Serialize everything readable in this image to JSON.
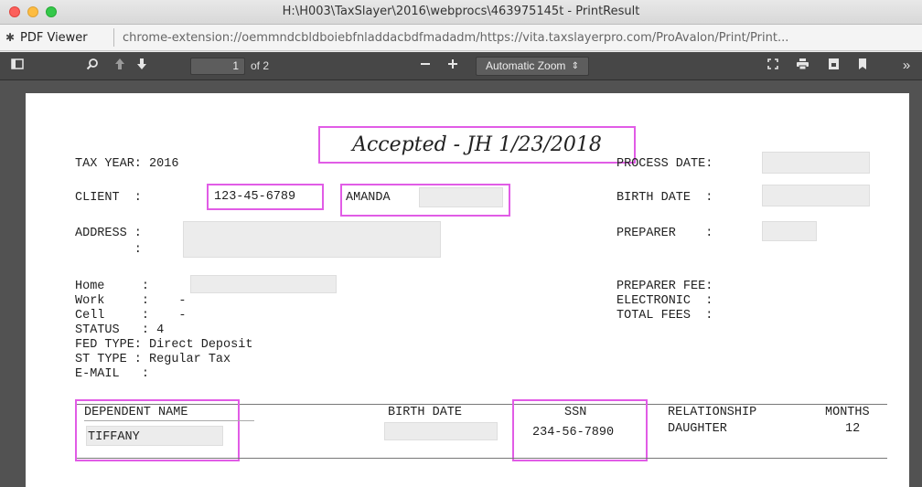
{
  "window": {
    "title": "H:\\H003\\TaxSlayer\\2016\\webprocs\\463975145t - PrintResult"
  },
  "urlbar": {
    "app_label": "PDF Viewer",
    "url": "chrome-extension://oemmndcbldboiebfnladdacbdfmadadm/https://vita.taxslayerpro.com/ProAvalon/Print/Print..."
  },
  "toolbar": {
    "page_number": "1",
    "page_count": "of 2",
    "zoom": "Automatic Zoom",
    "icons": [
      "sidebar-toggle-icon",
      "search-icon",
      "page-up-icon",
      "page-down-icon",
      "zoom-out-icon",
      "zoom-in-icon",
      "presentation-mode-icon",
      "print-icon",
      "download-icon",
      "bookmark-icon",
      "more-tools-icon"
    ]
  },
  "document": {
    "stamp": "Accepted - JH 1/23/2018",
    "tax_year_label": "TAX YEAR: 2016",
    "client_label": "CLIENT  :",
    "client_ssn": "123-45-6789",
    "client_first_name": "AMANDA",
    "address_label": "ADDRESS :",
    "address_colon": "        :",
    "home_label": "Home     :",
    "work_label": "Work     :    -",
    "cell_label": "Cell     :    -",
    "status_line": "STATUS   : 4",
    "fed_type_line": "FED TYPE: Direct Deposit",
    "st_type_line": "ST TYPE : Regular Tax",
    "email_line": "E-MAIL   :",
    "process_date_label": "PROCESS DATE:",
    "birth_date_label": "BIRTH DATE  :",
    "preparer_label": "PREPARER    :",
    "preparer_fee_label": "PREPARER FEE:",
    "electronic_label": "ELECTRONIC  :",
    "total_fees_label": "TOTAL FEES  :",
    "dependents": {
      "headers": [
        "DEPENDENT NAME",
        "BIRTH DATE",
        "SSN",
        "RELATIONSHIP",
        "MONTHS"
      ],
      "rows": [
        {
          "name": "TIFFANY",
          "birth_date": "",
          "ssn": "234-56-7890",
          "relationship": "DAUGHTER",
          "months": "12"
        }
      ]
    }
  },
  "colors": {
    "highlight": "#e15ce6",
    "toolbar_bg": "#474747",
    "viewer_bg": "#525252"
  }
}
